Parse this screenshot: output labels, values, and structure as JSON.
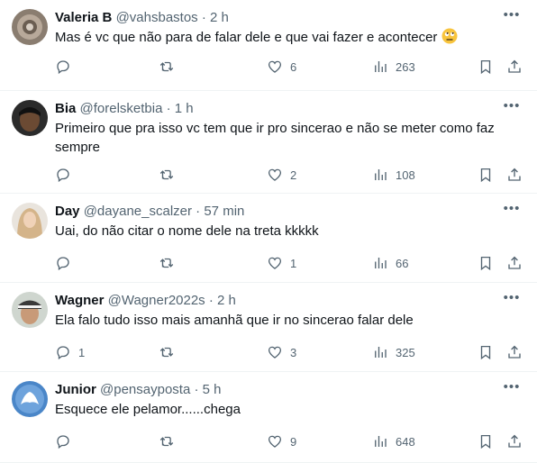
{
  "tweets": [
    {
      "name": "Valeria B",
      "handle": "@vahsbastos",
      "separator": "·",
      "time": "2 h",
      "text": "Mas é vc que não para de falar dele e que vai fazer e acontecer",
      "emoji": "face-with-rolling-eyes-icon",
      "replies": "",
      "retweets": "",
      "likes": "6",
      "views": "263"
    },
    {
      "name": "Bia",
      "handle": "@forelsketbia",
      "separator": "·",
      "time": "1 h",
      "text": "Primeiro que pra isso vc tem que ir pro sincerao e não se meter como faz sempre",
      "replies": "",
      "retweets": "",
      "likes": "2",
      "views": "108"
    },
    {
      "name": "Day",
      "handle": "@dayane_scalzer",
      "separator": "·",
      "time": "57 min",
      "text": "Uai, do não citar o nome dele na treta kkkkk",
      "replies": "",
      "retweets": "",
      "likes": "1",
      "views": "66"
    },
    {
      "name": "Wagner",
      "handle": "@Wagner2022s",
      "separator": "·",
      "time": "2 h",
      "text": "Ela falo tudo isso mais amanhã que ir no sincerao falar dele",
      "replies": "1",
      "retweets": "",
      "likes": "3",
      "views": "325"
    },
    {
      "name": "Junior",
      "handle": "@pensayposta",
      "separator": "·",
      "time": "5 h",
      "text": "Esquece ele pelamor......chega",
      "replies": "",
      "retweets": "",
      "likes": "9",
      "views": "648"
    }
  ],
  "icons": {
    "reply": "reply-icon",
    "retweet": "retweet-icon",
    "like": "heart-icon",
    "views": "views-chart-icon",
    "bookmark": "bookmark-icon",
    "share": "share-icon",
    "more": "more-dots-icon"
  },
  "colors": {
    "text": "#0f1419",
    "secondary": "#536471",
    "divider": "#eff3f4"
  }
}
